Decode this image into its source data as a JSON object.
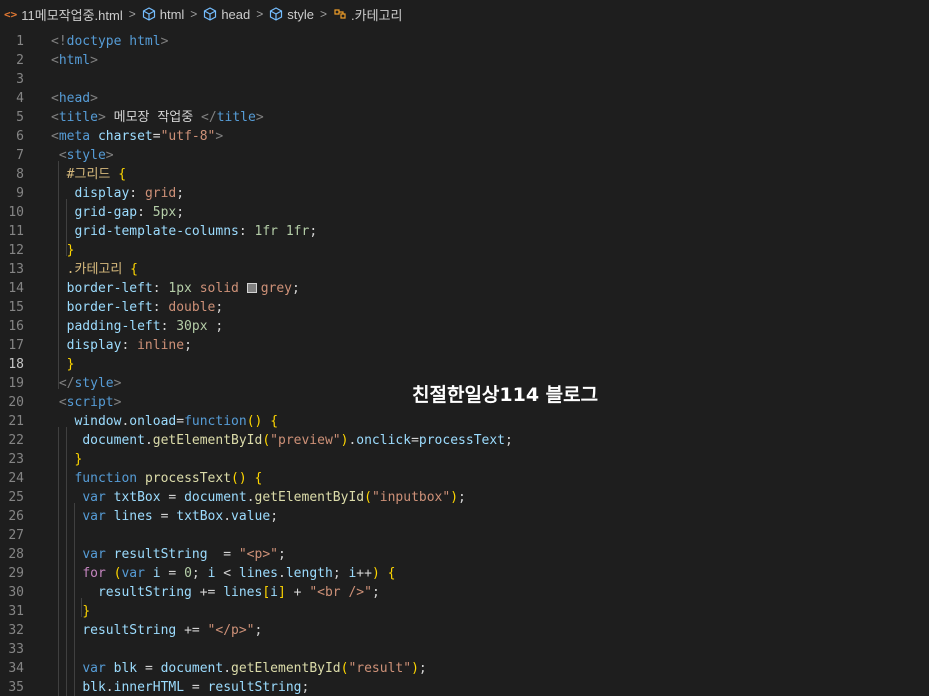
{
  "breadcrumb": {
    "file": "11메모작업중.html",
    "items": [
      "html",
      "head",
      "style"
    ],
    "symbol": ".카테고리"
  },
  "watermark": "친절한일상114 블로그",
  "colors": {
    "background": "#1e1e1e",
    "line_number": "#858585",
    "tag": "#569cd6",
    "string": "#ce9178",
    "property": "#9cdcfe",
    "number": "#b5cea8",
    "keyword": "#569cd6",
    "control": "#c586c0",
    "function": "#dcdcaa",
    "selector": "#d7ba7d"
  },
  "active_line": 18,
  "lines": [
    {
      "n": "1",
      "code": "<!doctype html>"
    },
    {
      "n": "2",
      "code": "<html>"
    },
    {
      "n": "3",
      "code": ""
    },
    {
      "n": "4",
      "code": "<head>"
    },
    {
      "n": "5",
      "code": "<title> 메모장 작업중 </title>"
    },
    {
      "n": "6",
      "code": "<meta charset=\"utf-8\">"
    },
    {
      "n": "7",
      "code": " <style>"
    },
    {
      "n": "8",
      "code": "  #그리드 {"
    },
    {
      "n": "9",
      "code": "   display: grid;"
    },
    {
      "n": "10",
      "code": "   grid-gap: 5px;"
    },
    {
      "n": "11",
      "code": "   grid-template-columns: 1fr 1fr;"
    },
    {
      "n": "12",
      "code": "  }"
    },
    {
      "n": "13",
      "code": "  .카테고리 {"
    },
    {
      "n": "14",
      "code": "  border-left: 1px solid grey;"
    },
    {
      "n": "15",
      "code": "  border-left: double;"
    },
    {
      "n": "16",
      "code": "  padding-left: 30px ;"
    },
    {
      "n": "17",
      "code": "  display: inline;"
    },
    {
      "n": "18",
      "code": "  }"
    },
    {
      "n": "19",
      "code": " </style>"
    },
    {
      "n": "20",
      "code": " <script>"
    },
    {
      "n": "21",
      "code": "   window.onload=function() {"
    },
    {
      "n": "22",
      "code": "    document.getElementById(\"preview\").onclick=processText;"
    },
    {
      "n": "23",
      "code": "   }"
    },
    {
      "n": "24",
      "code": "   function processText() {"
    },
    {
      "n": "25",
      "code": "    var txtBox = document.getElementById(\"inputbox\");"
    },
    {
      "n": "26",
      "code": "    var lines = txtBox.value;"
    },
    {
      "n": "27",
      "code": ""
    },
    {
      "n": "28",
      "code": "    var resultString  = \"<p>\";"
    },
    {
      "n": "29",
      "code": "    for (var i = 0; i < lines.length; i++) {"
    },
    {
      "n": "30",
      "code": "      resultString += lines[i] + \"<br />\";"
    },
    {
      "n": "31",
      "code": "    }"
    },
    {
      "n": "32",
      "code": "    resultString += \"</p>\";"
    },
    {
      "n": "33",
      "code": ""
    },
    {
      "n": "34",
      "code": "    var blk = document.getElementById(\"result\");"
    },
    {
      "n": "35",
      "code": "    blk.innerHTML = resultString;"
    }
  ]
}
